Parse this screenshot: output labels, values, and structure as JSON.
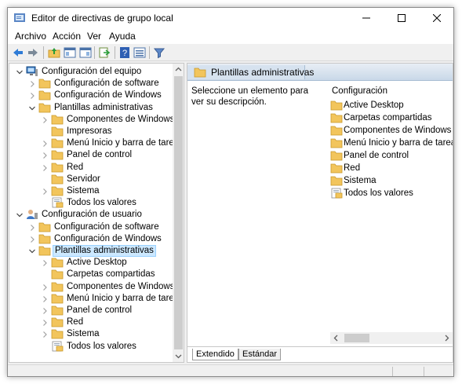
{
  "window": {
    "title": "Editor de directivas de grupo local"
  },
  "menu": [
    "Archivo",
    "Acción",
    "Ver",
    "Ayuda"
  ],
  "toolbar_icons": [
    "back-icon",
    "forward-icon",
    "up-folder-icon",
    "show-hide-tree-icon",
    "properties-icon",
    "export-list-icon",
    "help-icon",
    "view-icon",
    "filter-icon"
  ],
  "tree": [
    {
      "label": "Configuración del equipo",
      "level": 0,
      "expanded": true,
      "icon": "computer-icon"
    },
    {
      "label": "Configuración de software",
      "level": 1,
      "expanded": false,
      "icon": "folder-icon"
    },
    {
      "label": "Configuración de Windows",
      "level": 1,
      "expanded": false,
      "icon": "folder-icon"
    },
    {
      "label": "Plantillas administrativas",
      "level": 1,
      "expanded": true,
      "icon": "folder-icon"
    },
    {
      "label": "Componentes de Windows",
      "level": 2,
      "expanded": false,
      "icon": "folder-icon"
    },
    {
      "label": "Impresoras",
      "level": 2,
      "expanded": null,
      "icon": "folder-icon"
    },
    {
      "label": "Menú Inicio y barra de tareas",
      "level": 2,
      "expanded": false,
      "icon": "folder-icon"
    },
    {
      "label": "Panel de control",
      "level": 2,
      "expanded": false,
      "icon": "folder-icon"
    },
    {
      "label": "Red",
      "level": 2,
      "expanded": false,
      "icon": "folder-icon"
    },
    {
      "label": "Servidor",
      "level": 2,
      "expanded": null,
      "icon": "folder-icon"
    },
    {
      "label": "Sistema",
      "level": 2,
      "expanded": false,
      "icon": "folder-icon"
    },
    {
      "label": "Todos los valores",
      "level": 2,
      "expanded": null,
      "icon": "all-settings-icon"
    },
    {
      "label": "Configuración de usuario",
      "level": 0,
      "expanded": true,
      "icon": "user-icon"
    },
    {
      "label": "Configuración de software",
      "level": 1,
      "expanded": false,
      "icon": "folder-icon"
    },
    {
      "label": "Configuración de Windows",
      "level": 1,
      "expanded": false,
      "icon": "folder-icon"
    },
    {
      "label": "Plantillas administrativas",
      "level": 1,
      "expanded": true,
      "icon": "folder-icon",
      "selected": true
    },
    {
      "label": "Active Desktop",
      "level": 2,
      "expanded": false,
      "icon": "folder-icon"
    },
    {
      "label": "Carpetas compartidas",
      "level": 2,
      "expanded": null,
      "icon": "folder-icon"
    },
    {
      "label": "Componentes de Windows",
      "level": 2,
      "expanded": false,
      "icon": "folder-icon"
    },
    {
      "label": "Menú Inicio y barra de tareas",
      "level": 2,
      "expanded": false,
      "icon": "folder-icon"
    },
    {
      "label": "Panel de control",
      "level": 2,
      "expanded": false,
      "icon": "folder-icon"
    },
    {
      "label": "Red",
      "level": 2,
      "expanded": false,
      "icon": "folder-icon"
    },
    {
      "label": "Sistema",
      "level": 2,
      "expanded": false,
      "icon": "folder-icon"
    },
    {
      "label": "Todos los valores",
      "level": 2,
      "expanded": null,
      "icon": "all-settings-icon"
    }
  ],
  "right": {
    "header": "Plantillas administrativas",
    "description": "Seleccione un elemento para ver su descripción.",
    "list_title": "Configuración",
    "items": [
      {
        "label": "Active Desktop",
        "icon": "folder-icon"
      },
      {
        "label": "Carpetas compartidas",
        "icon": "folder-icon"
      },
      {
        "label": "Componentes de Windows",
        "icon": "folder-icon"
      },
      {
        "label": "Menú Inicio y barra de tareas",
        "icon": "folder-icon"
      },
      {
        "label": "Panel de control",
        "icon": "folder-icon"
      },
      {
        "label": "Red",
        "icon": "folder-icon"
      },
      {
        "label": "Sistema",
        "icon": "folder-icon"
      },
      {
        "label": "Todos los valores",
        "icon": "all-settings-icon"
      }
    ]
  },
  "tabs": [
    "Extendido",
    "Estándar"
  ],
  "colors": {
    "selection": "#cce8ff",
    "selection_border": "#99d1ff",
    "folder": "#f2c55c",
    "accent": "#3b82c4"
  }
}
